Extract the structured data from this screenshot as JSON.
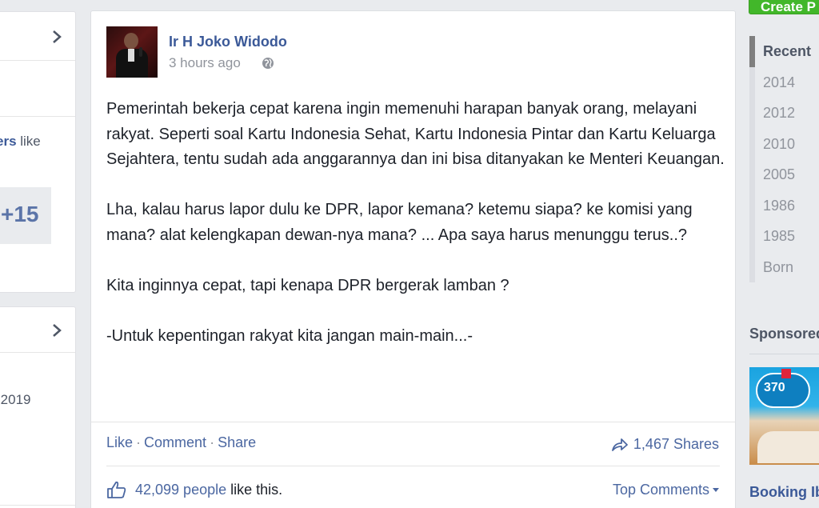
{
  "left_column": {
    "card1": {
      "friends_text_bold": "ers",
      "friends_text_rest": " like",
      "more_count": "+15"
    },
    "card2": {
      "year_range": "-2019"
    }
  },
  "post": {
    "author": "Ir H Joko Widodo",
    "timestamp": "3 hours ago",
    "paragraphs": [
      "Pemerintah bekerja cepat karena ingin memenuhi harapan banyak orang, melayani rakyat. Seperti soal Kartu Indonesia Sehat, Kartu Indonesia Pintar dan Kartu Keluarga Sejahtera, tentu sudah ada anggarannya dan ini bisa ditanyakan ke Menteri Keuangan.",
      "Lha, kalau harus lapor dulu ke DPR, lapor kemana? ketemu siapa? ke komisi yang mana? alat kelengkapan dewan-nya mana? ... Apa saya harus menunggu terus..?",
      "Kita inginnya cepat, tapi kenapa DPR bergerak lamban ?",
      "-Untuk kepentingan rakyat kita jangan main-main...-"
    ],
    "actions": {
      "like": "Like",
      "comment": "Comment",
      "share": "Share",
      "separator": "·"
    },
    "shares": "1,467 Shares",
    "likes_count": "42,099 people",
    "likes_suffix": "like this.",
    "top_comments": "Top Comments"
  },
  "right_column": {
    "create_button": "Create P",
    "timeline": [
      "Recent",
      "2014",
      "2012",
      "2010",
      "2005",
      "1986",
      "1985",
      "Born"
    ],
    "sponsored_heading": "Sponsored",
    "ad_price": "370",
    "ad_title": "Booking Ib"
  },
  "colors": {
    "link_blue": "#3b5998",
    "page_bg": "#e9ebee",
    "create_green": "#42b72a"
  }
}
